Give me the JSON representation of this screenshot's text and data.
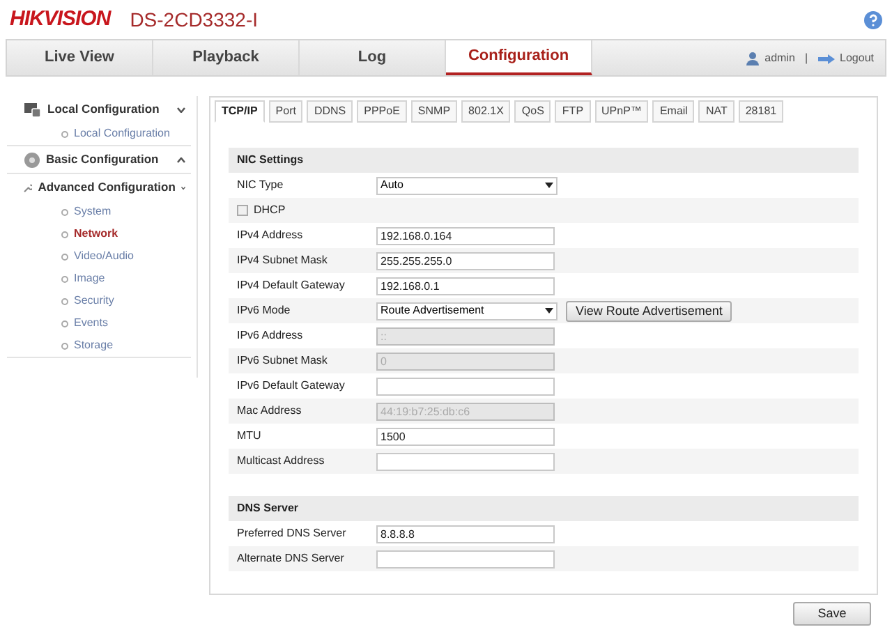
{
  "header": {
    "logo": "HIKVISION",
    "model": "DS-2CD3332-I"
  },
  "nav": {
    "tabs": [
      {
        "label": "Live View",
        "selected": false
      },
      {
        "label": "Playback",
        "selected": false
      },
      {
        "label": "Log",
        "selected": false
      },
      {
        "label": "Configuration",
        "selected": true
      }
    ],
    "user": "admin",
    "separator": "|",
    "logout": "Logout"
  },
  "sidebar": [
    {
      "label": "Local Configuration",
      "expanded": true,
      "children": [
        {
          "label": "Local Configuration",
          "selected": false
        }
      ]
    },
    {
      "label": "Basic Configuration",
      "expanded": false
    },
    {
      "label": "Advanced Configuration",
      "expanded": true,
      "children": [
        {
          "label": "System",
          "selected": false
        },
        {
          "label": "Network",
          "selected": true
        },
        {
          "label": "Video/Audio",
          "selected": false
        },
        {
          "label": "Image",
          "selected": false
        },
        {
          "label": "Security",
          "selected": false
        },
        {
          "label": "Events",
          "selected": false
        },
        {
          "label": "Storage",
          "selected": false
        }
      ]
    }
  ],
  "tabs": [
    {
      "label": "TCP/IP",
      "selected": true
    },
    {
      "label": "Port",
      "selected": false
    },
    {
      "label": "DDNS",
      "selected": false
    },
    {
      "label": "PPPoE",
      "selected": false
    },
    {
      "label": "SNMP",
      "selected": false
    },
    {
      "label": "802.1X",
      "selected": false
    },
    {
      "label": "QoS",
      "selected": false
    },
    {
      "label": "FTP",
      "selected": false
    },
    {
      "label": "UPnP™",
      "selected": false
    },
    {
      "label": "Email",
      "selected": false
    },
    {
      "label": "NAT",
      "selected": false
    },
    {
      "label": "28181",
      "selected": false
    }
  ],
  "sections": [
    {
      "title": "NIC Settings",
      "rows": [
        {
          "kind": "select",
          "label": "NIC Type",
          "value": "Auto"
        },
        {
          "kind": "checkbox",
          "label": "DHCP",
          "checked": false
        },
        {
          "kind": "input",
          "label": "IPv4 Address",
          "value": "192.168.0.164",
          "disabled": false
        },
        {
          "kind": "input",
          "label": "IPv4 Subnet Mask",
          "value": "255.255.255.0",
          "disabled": false
        },
        {
          "kind": "input",
          "label": "IPv4 Default Gateway",
          "value": "192.168.0.1",
          "disabled": false
        },
        {
          "kind": "select",
          "label": "IPv6 Mode",
          "value": "Route Advertisement",
          "button": "View Route Advertisement"
        },
        {
          "kind": "input",
          "label": "IPv6 Address",
          "value": "::",
          "disabled": true
        },
        {
          "kind": "input",
          "label": "IPv6 Subnet Mask",
          "value": "0",
          "disabled": true
        },
        {
          "kind": "input",
          "label": "IPv6 Default Gateway",
          "disabled": false
        },
        {
          "kind": "input",
          "label": "Mac Address",
          "value": "44:19:b7:25:db:c6",
          "disabled": true
        },
        {
          "kind": "input",
          "label": "MTU",
          "value": "1500",
          "disabled": false
        },
        {
          "kind": "input",
          "label": "Multicast Address",
          "disabled": false
        }
      ]
    },
    {
      "title": "DNS Server",
      "rows": [
        {
          "kind": "input",
          "label": "Preferred DNS Server",
          "value": "8.8.8.8",
          "disabled": false
        },
        {
          "kind": "input",
          "label": "Alternate DNS Server",
          "disabled": false
        }
      ]
    }
  ],
  "save": "Save"
}
